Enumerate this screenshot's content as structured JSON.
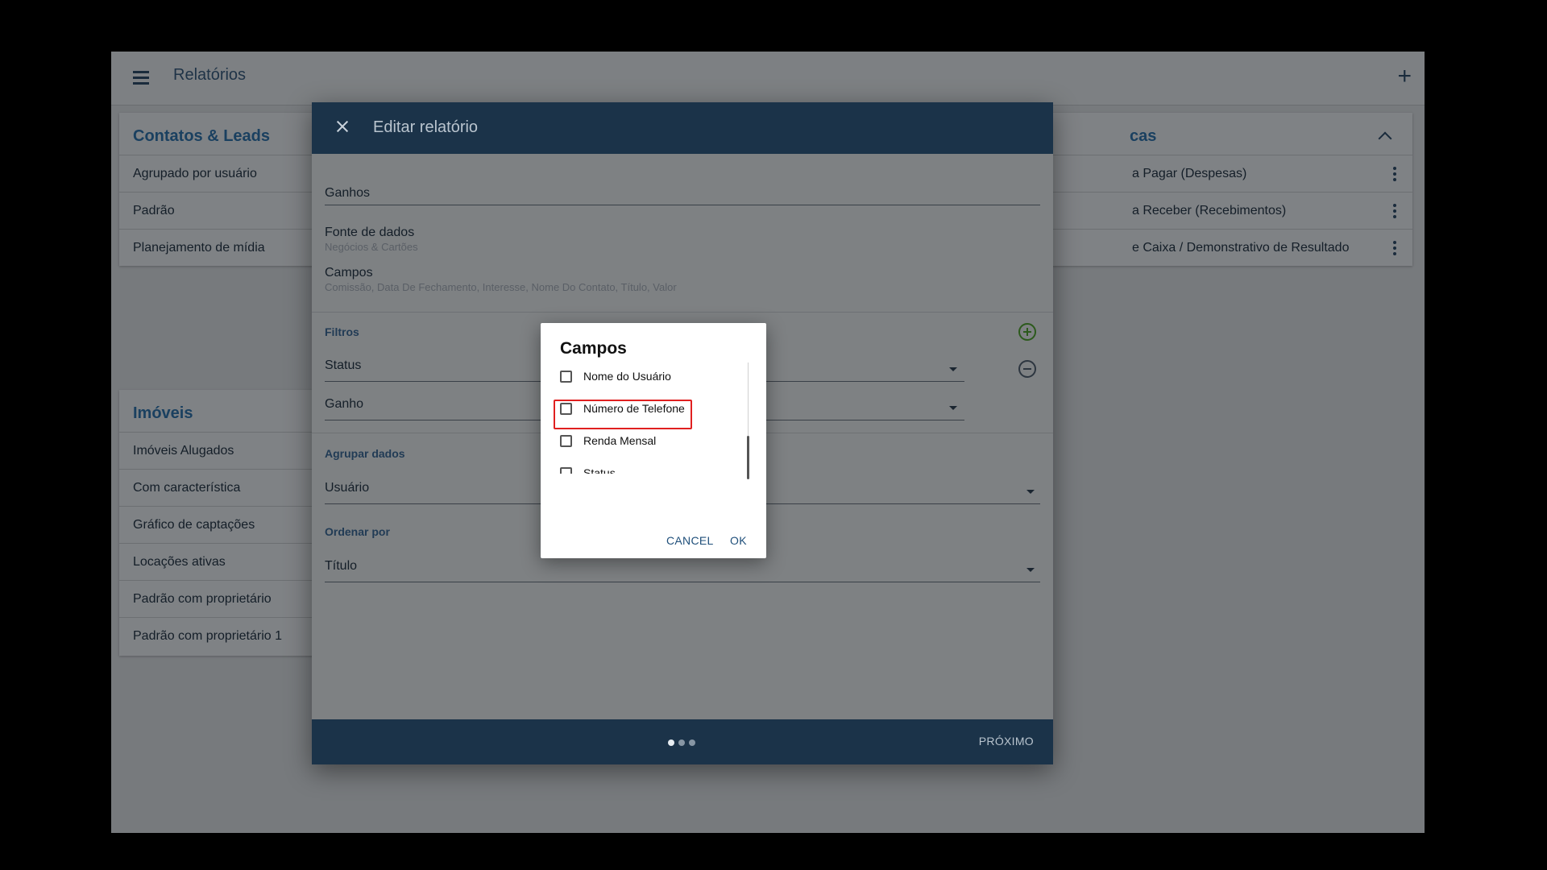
{
  "app": {
    "title": "Relatórios"
  },
  "cards": {
    "contatos": {
      "title": "Contatos & Leads",
      "items": [
        "Agrupado por usuário",
        "Padrão",
        "Planejamento de mídia"
      ]
    },
    "imoveis": {
      "title": "Imóveis",
      "items": [
        "Imóveis Alugados",
        "Com característica",
        "Gráfico de captações",
        "Locações ativas",
        "Padrão com proprietário",
        "Padrão com proprietário 1"
      ]
    },
    "financas": {
      "title": "cas",
      "items": [
        "a Pagar (Despesas)",
        "a Receber (Recebimentos)",
        "e Caixa / Demonstrativo de Resultado"
      ]
    }
  },
  "edit_dialog": {
    "title": "Editar relatório",
    "name_value": "Ganhos",
    "data_source": {
      "label": "Fonte de dados",
      "value": "Negócios & Cartões"
    },
    "fields": {
      "label": "Campos",
      "value": "Comissão, Data De Fechamento, Interesse, Nome Do Contato, Título, Valor"
    },
    "filters": {
      "label": "Filtros",
      "filter_1": "Status",
      "filter_2": "Ganho"
    },
    "group": {
      "label": "Agrupar dados",
      "value": "Usuário"
    },
    "order": {
      "label": "Ordenar por",
      "value": "Título"
    },
    "next_label": "PRÓXIMO",
    "steps": {
      "total": 3,
      "current": 1
    }
  },
  "campos_dialog": {
    "title": "Campos",
    "options": [
      "Nome do Usuário",
      "Número de Telefone",
      "Renda Mensal",
      "Status"
    ],
    "cancel_label": "CANCEL",
    "ok_label": "OK"
  },
  "colors": {
    "header": "#1b3349",
    "highlight": "#e02020",
    "accent_link": "#1f4f7a"
  }
}
